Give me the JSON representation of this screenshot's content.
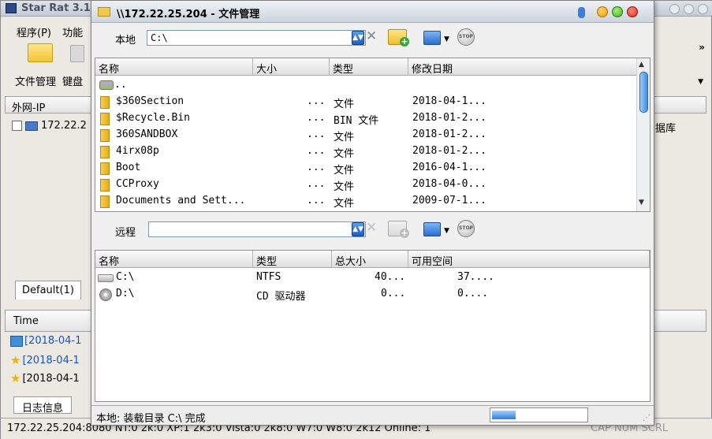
{
  "main_window": {
    "title": "Star Rat 3.1",
    "menu": [
      "程序(P)",
      "功能"
    ],
    "toolbar_labels": [
      "文件管理",
      "键盘"
    ],
    "column_header": "外网-IP",
    "host_row": "172.22.2",
    "right_column_text": "据库",
    "tab_default": "Default(1)",
    "time_header": "Time",
    "log_entries": [
      {
        "text": "[2018-04-1",
        "color": "#1a55c8",
        "icon": "network-icon"
      },
      {
        "text": "[2018-04-1",
        "color": "#1a55c8",
        "icon": "star-icon"
      },
      {
        "text": "[2018-04-1",
        "color": "#000000",
        "icon": "star-icon"
      }
    ],
    "log_tab": "日志信息",
    "status_left": "172.22.25.204:8080   NT:0    2k:0    XP:1    2k3:0   Vista:0  2k8:0   W7:0    W8:0    2k12  Online: 1",
    "status_right": "CAP  NUM  SCRL"
  },
  "dialog": {
    "title": "\\\\172.22.25.204 - 文件管理",
    "local": {
      "label": "本地",
      "path": "C:\\",
      "columns": [
        "名称",
        "大小",
        "类型",
        "修改日期"
      ],
      "rows": [
        {
          "name": "..",
          "size": "",
          "type": "",
          "date": "",
          "icon": "up-folder-icon"
        },
        {
          "name": "$360Section",
          "size": "...",
          "type": "文件",
          "date": "2018-04-1...",
          "icon": "folder-icon"
        },
        {
          "name": "$Recycle.Bin",
          "size": "...",
          "type": "BIN 文件",
          "date": "2018-01-2...",
          "icon": "folder-icon"
        },
        {
          "name": "360SANDBOX",
          "size": "...",
          "type": "文件",
          "date": "2018-01-2...",
          "icon": "folder-icon"
        },
        {
          "name": "4irx08p",
          "size": "...",
          "type": "文件",
          "date": "2018-01-2...",
          "icon": "folder-icon"
        },
        {
          "name": "Boot",
          "size": "...",
          "type": "文件",
          "date": "2016-04-1...",
          "icon": "folder-icon"
        },
        {
          "name": "CCProxy",
          "size": "...",
          "type": "文件",
          "date": "2018-04-0...",
          "icon": "folder-icon"
        },
        {
          "name": "Documents and Sett...",
          "size": "...",
          "type": "文件",
          "date": "2009-07-1...",
          "icon": "folder-icon"
        }
      ]
    },
    "remote": {
      "label": "远程",
      "path": "",
      "columns": [
        "名称",
        "类型",
        "总大小",
        "可用空间"
      ],
      "rows": [
        {
          "name": "C:\\",
          "type": "NTFS",
          "total": "40...",
          "free": "37....",
          "icon": "hard-drive-icon"
        },
        {
          "name": "D:\\",
          "type": "CD 驱动器",
          "total": "0...",
          "free": "0....",
          "icon": "cd-drive-icon"
        }
      ]
    },
    "status": "本地: 装载目录 C:\\ 完成",
    "progress": 0.25,
    "stop_label": "STOP"
  }
}
